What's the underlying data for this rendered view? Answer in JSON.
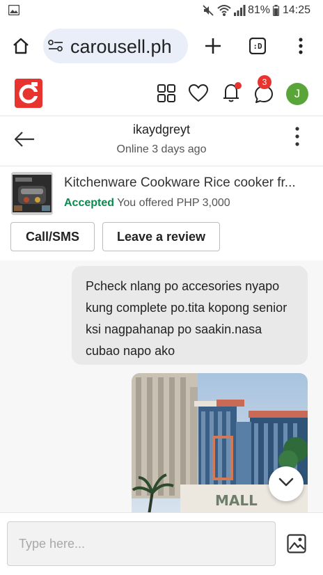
{
  "status_bar": {
    "battery": "81%",
    "time": "14:25"
  },
  "browser": {
    "url": "carousell.ph"
  },
  "app_header": {
    "brand_color": "#e8342f",
    "notification_dot_color": "#e8342f",
    "chat_badge_count": "3",
    "avatar_initial": "J",
    "avatar_color": "#5aa53a"
  },
  "chat_header": {
    "username": "ikaydgreyt",
    "status": "Online 3 days ago"
  },
  "listing": {
    "title": "Kitchenware Cookware Rice cooker fr...",
    "status": "Accepted",
    "offer_text": "You offered PHP 3,000",
    "buttons": {
      "call": "Call/SMS",
      "review": "Leave a review"
    }
  },
  "messages": [
    {
      "type": "text",
      "text": "Pcheck nlang po accesories nyapo kung complete po.tita kopong senior ksi nagpahanap po saakin.nasa cubao napo ako"
    },
    {
      "type": "image",
      "icon": "photo-building-icon",
      "sign_text": "MALL"
    }
  ],
  "composer": {
    "placeholder": "Type here..."
  }
}
